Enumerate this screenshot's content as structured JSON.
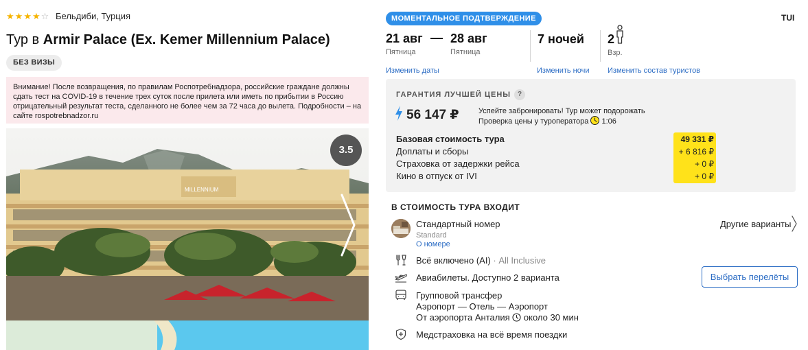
{
  "hotel": {
    "stars_filled": 4,
    "stars_total": 5,
    "location": "Бельдиби, Турция",
    "title_prefix": "Тур в",
    "title_name": "Armir Palace (Ex. Kemer Millennium Palace)",
    "visa_badge": "БЕЗ ВИЗЫ",
    "notice": "Внимание! После возвращения, по правилам Роспотребнадзора, российские граждане должны сдать тест на COVID-19 в течение трех суток после прилета или иметь по прибытии в Россию отрицательный результат теста, сделанного не более чем за 72 часа до вылета. Подробности – на сайте rospotrebnadzor.ru",
    "rating": "3.5",
    "photo_sign": "MILLENNIUM"
  },
  "booking": {
    "instant_badge": "МОМЕНТАЛЬНОЕ ПОДТВЕРЖДЕНИЕ",
    "operator": "TUI",
    "date_from": "21 авг",
    "date_from_day": "Пятница",
    "dash": "—",
    "date_to": "28 авг",
    "date_to_day": "Пятница",
    "nights": "7 ночей",
    "adults_count": "2",
    "adults_label": "Взр.",
    "change_dates": "Изменить даты",
    "change_nights": "Изменить ночи",
    "change_tourists": "Изменить состав туристов"
  },
  "price": {
    "guarantee": "ГАРАНТИЯ ЛУЧШЕЙ ЦЕНЫ",
    "help": "?",
    "total": "56 147 ₽",
    "note_line1": "Успейте забронировать! Тур может подорожать",
    "note_line2": "Проверка цены у туроператора",
    "timer": "1:06",
    "rows": [
      {
        "label": "Базовая стоимость тура",
        "value": "49 331 ₽"
      },
      {
        "label": "Доплаты и сборы",
        "value": "+ 6 816 ₽"
      },
      {
        "label": "Страховка от задержки рейса",
        "value": "+ 0 ₽"
      },
      {
        "label": "Кино в отпуск от IVI",
        "value": "+ 0 ₽"
      }
    ]
  },
  "includes": {
    "heading": "В СТОИМОСТЬ ТУРА ВХОДИТ",
    "room": "Стандартный номер",
    "room_sub": "Standard",
    "room_link": "О номере",
    "other_variants": "Другие варианты",
    "meal": "Всё включено (AI)",
    "meal_sub": " · All Inclusive",
    "flights": "Авиабилеты. Доступно 2 варианта",
    "choose_flights": "Выбрать перелёты",
    "transfer_1": "Групповой трансфер",
    "transfer_2": "Аэропорт — Отель — Аэропорт",
    "transfer_3": "От аэропорта Анталия",
    "transfer_time": "около 30 мин",
    "insurance": "Медстраховка на всё время поездки"
  },
  "colors": {
    "accent": "#2f8fe8",
    "link": "#2b6cc4",
    "highlight": "#ffe21a",
    "notice_bg": "#fbe9ec",
    "star": "#f6b400"
  }
}
